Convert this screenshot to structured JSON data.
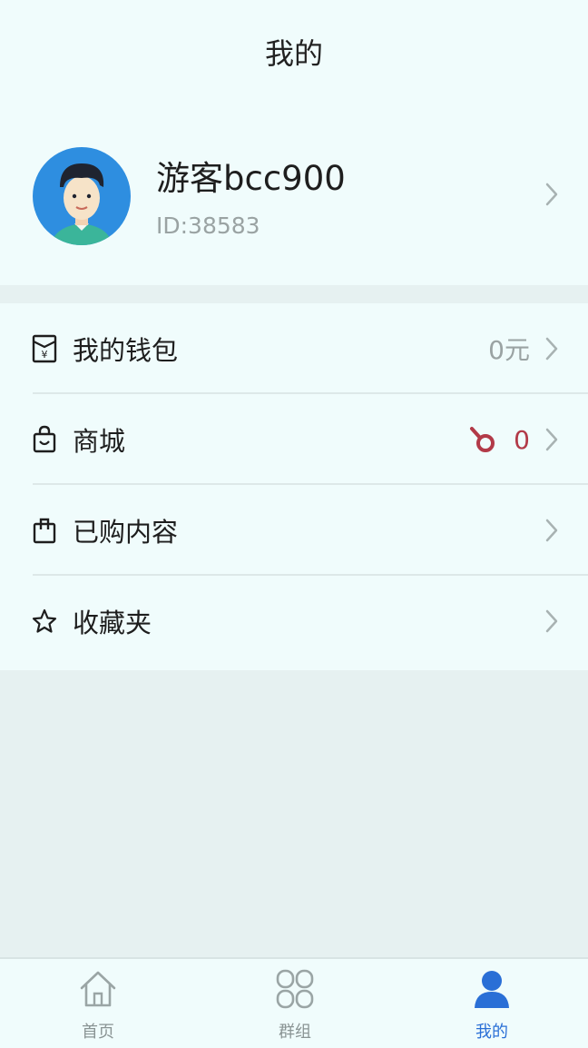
{
  "header": {
    "title": "我的"
  },
  "profile": {
    "username": "游客bcc900",
    "user_id": "ID:38583"
  },
  "menu": {
    "items": [
      {
        "label": "我的钱包",
        "value": "0元",
        "icon": "wallet-icon"
      },
      {
        "label": "商城",
        "coin_value": "0",
        "icon": "shopping-bag-icon"
      },
      {
        "label": "已购内容",
        "icon": "purchased-bag-icon"
      },
      {
        "label": "收藏夹",
        "icon": "star-icon"
      }
    ]
  },
  "tabbar": {
    "tabs": [
      {
        "label": "首页",
        "icon": "home-icon",
        "active": false
      },
      {
        "label": "群组",
        "icon": "group-icon",
        "active": false
      },
      {
        "label": "我的",
        "icon": "profile-icon",
        "active": true
      }
    ]
  },
  "colors": {
    "accent": "#2a6fd6",
    "coin": "#b23a48",
    "background": "#f0fcfc"
  }
}
